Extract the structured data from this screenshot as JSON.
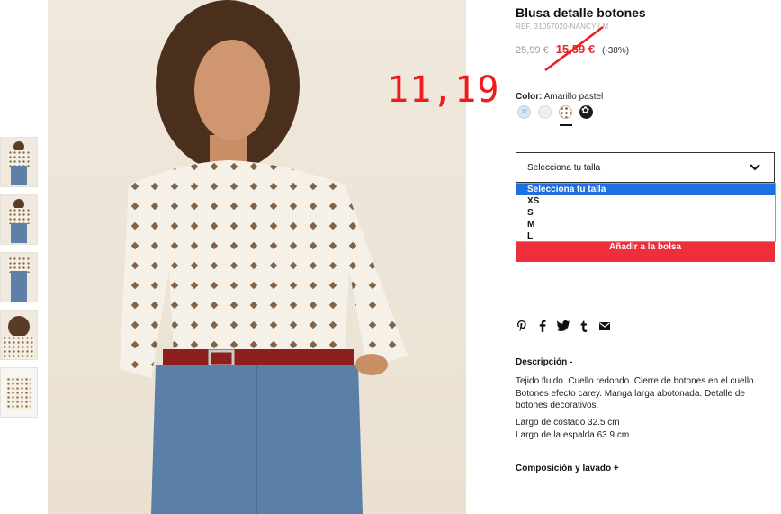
{
  "product": {
    "title": "Blusa detalle botones",
    "ref": "REF. 31057020-NANCY-LM",
    "old_price": "25,99 €",
    "new_price": "15,59 €",
    "discount": "(-38%)"
  },
  "annotation": "11,19",
  "color": {
    "label": "Color:",
    "value": "Amarillo pastel",
    "swatches": [
      "light-blue",
      "light-grey",
      "cream-print",
      "black-print"
    ]
  },
  "size_select": {
    "placeholder": "Selecciona tu talla",
    "options": [
      "Selecciona tu talla",
      "XS",
      "S",
      "M",
      "L"
    ]
  },
  "add_to_bag": "Añadir a la bolsa",
  "share_icons": [
    "pinterest-icon",
    "facebook-icon",
    "twitter-icon",
    "tumblr-icon",
    "email-icon"
  ],
  "description": {
    "heading": "Descripción -",
    "text": "Tejido fluido. Cuello redondo. Cierre de botones en el cuello. Botones efecto carey. Manga larga abotonada. Detalle de botones decorativos.",
    "measure_1": "Largo de costado 32.5 cm",
    "measure_2": "Largo de la espalda 63.9 cm"
  },
  "composition": {
    "heading": "Composición y lavado +"
  },
  "colors": {
    "accent_red": "#ee2e3a",
    "price_red": "#e52727",
    "selected_option": "#1e6fe0"
  }
}
